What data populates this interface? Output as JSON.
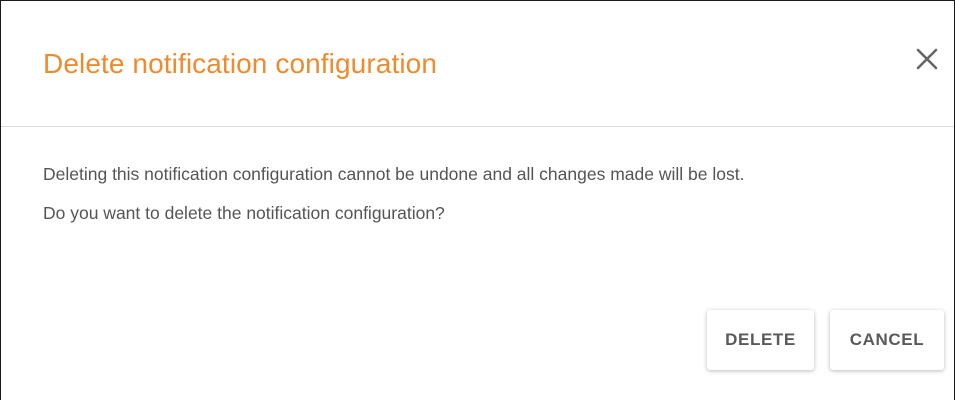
{
  "dialog": {
    "title": "Delete notification configuration",
    "close_icon": "close-icon",
    "message": "Deleting this notification configuration cannot be undone and all changes made will be lost.",
    "question": "Do you want to delete the notification configuration?",
    "delete_label": "DELETE",
    "cancel_label": "CANCEL"
  },
  "colors": {
    "title": "#ee8b2e",
    "text": "#555555",
    "button_text": "#5a5a5a",
    "divider": "#dcdcdc"
  }
}
